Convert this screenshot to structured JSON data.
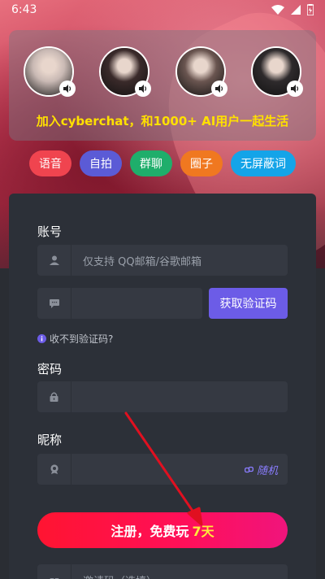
{
  "status": {
    "time": "6:43"
  },
  "banner": {
    "tagline": "加入cyberchat，和1000+ AI用户一起生活",
    "avatars": [
      {
        "name": "avatar-1",
        "tone": "#c9b9b4"
      },
      {
        "name": "avatar-2",
        "tone": "#3a2a2a"
      },
      {
        "name": "avatar-3",
        "tone": "#6a5550"
      },
      {
        "name": "avatar-4",
        "tone": "#2e2a2c"
      }
    ]
  },
  "chips": [
    {
      "label": "语音",
      "color": "#f0444f"
    },
    {
      "label": "自拍",
      "color": "#5b5bd6"
    },
    {
      "label": "群聊",
      "color": "#1fae6b"
    },
    {
      "label": "圈子",
      "color": "#f07820"
    },
    {
      "label": "无屏蔽词",
      "color": "#14a4e8"
    }
  ],
  "form": {
    "account_label": "账号",
    "account_placeholder": "仅支持 QQ邮箱/谷歌邮箱",
    "get_code_label": "获取验证码",
    "no_code_hint": "收不到验证码?",
    "password_label": "密码",
    "nickname_label": "昵称",
    "random_label": "随机",
    "submit_prefix": "注册，免费玩",
    "submit_days": "7天",
    "invite_placeholder": "邀请码（选填）"
  },
  "colors": {
    "accent": "#6c5ce7",
    "submit": "#ff1431",
    "arrow": "#e01020"
  }
}
